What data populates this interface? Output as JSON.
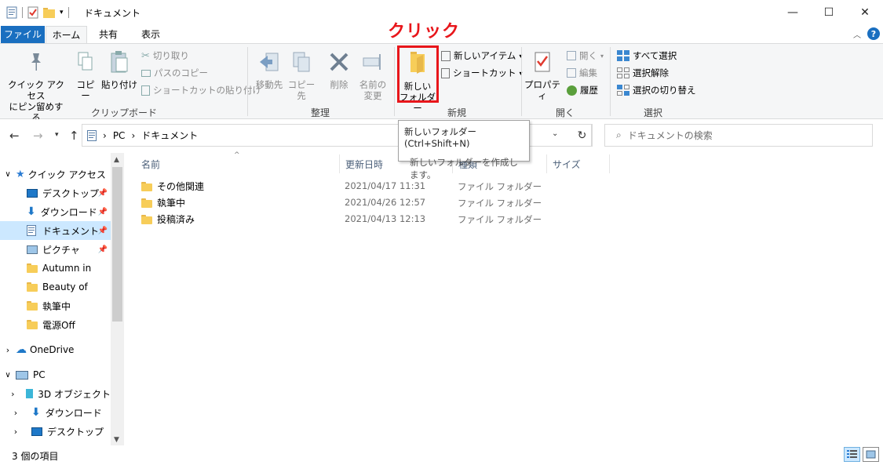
{
  "window": {
    "title": "ドキュメント",
    "minimize": "—",
    "maximize": "☐",
    "close": "✕"
  },
  "annotation": {
    "click_label": "クリック"
  },
  "tabs": {
    "file": "ファイル",
    "home": "ホーム",
    "share": "共有",
    "view": "表示"
  },
  "ribbon": {
    "clipboard": {
      "pin_label_1": "クイック アクセス",
      "pin_label_2": "にピン留めする",
      "copy": "コピー",
      "paste": "貼り付け",
      "cut": "切り取り",
      "copy_path": "パスのコピー",
      "paste_shortcut": "ショートカットの貼り付け",
      "group": "クリップボード"
    },
    "organize": {
      "move_to": "移動先",
      "copy_to": "コピー先",
      "delete": "削除",
      "rename_1": "名前の",
      "rename_2": "変更",
      "group": "整理"
    },
    "new": {
      "new_folder_1": "新しい",
      "new_folder_2": "フォルダー",
      "new_item": "新しいアイテム",
      "shortcut": "ショートカット",
      "group": "新規"
    },
    "open": {
      "properties": "プロパティ",
      "open": "開く",
      "edit": "編集",
      "history": "履歴",
      "group": "開く"
    },
    "select": {
      "select_all": "すべて選択",
      "select_none": "選択解除",
      "invert": "選択の切り替え",
      "group": "選択"
    }
  },
  "tooltip": {
    "title": "新しいフォルダー (Ctrl+Shift+N)",
    "desc": "新しいフォルダーを作成します。"
  },
  "address": {
    "pc": "PC",
    "sep": "›",
    "current": "ドキュメント"
  },
  "search": {
    "placeholder": "ドキュメントの検索"
  },
  "navpane": {
    "quick_access": "クイック アクセス",
    "items": [
      {
        "label": "デスクトップ",
        "pinned": true
      },
      {
        "label": "ダウンロード",
        "pinned": true
      },
      {
        "label": "ドキュメント",
        "pinned": true
      },
      {
        "label": "ピクチャ",
        "pinned": true
      },
      {
        "label": "Autumn in",
        "pinned": false
      },
      {
        "label": "Beauty of",
        "pinned": false
      },
      {
        "label": "執筆中",
        "pinned": false
      },
      {
        "label": "電源Off",
        "pinned": false
      }
    ],
    "onedrive": "OneDrive",
    "pc": "PC",
    "pc_items": [
      "3D オブジェクト",
      "ダウンロード",
      "デスクトップ"
    ]
  },
  "columns": {
    "name": "名前",
    "modified": "更新日時",
    "type": "種類",
    "size": "サイズ"
  },
  "files": [
    {
      "name": "その他関連",
      "modified": "2021/04/17 11:31",
      "type": "ファイル フォルダー"
    },
    {
      "name": "執筆中",
      "modified": "2021/04/26 12:57",
      "type": "ファイル フォルダー"
    },
    {
      "name": "投稿済み",
      "modified": "2021/04/13 12:13",
      "type": "ファイル フォルダー"
    }
  ],
  "status": {
    "count": "3 個の項目"
  },
  "colors": {
    "accent": "#1a6fc0",
    "selection": "#cce8ff",
    "annotation": "#e8161b",
    "folder": "#f7cd59"
  }
}
